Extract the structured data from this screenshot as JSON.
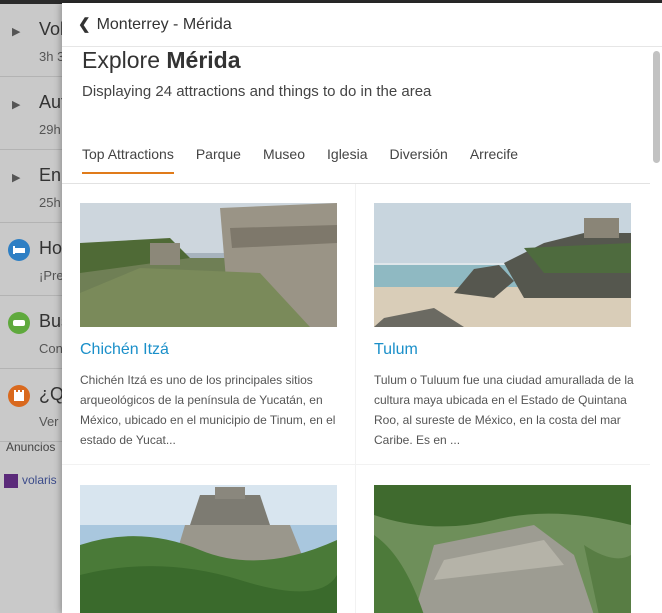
{
  "background": {
    "rows": [
      {
        "title": "Vol",
        "sub": "3h 3"
      },
      {
        "title": "Aut",
        "sub": "29h"
      },
      {
        "title": "En",
        "sub": "25h"
      },
      {
        "title": "Hot",
        "sub": "¡Pre"
      },
      {
        "title": "Bus",
        "sub": "Con"
      },
      {
        "title": "¿Qu",
        "sub": "Ver"
      }
    ],
    "ads_label": "Anuncios",
    "volaris_label": "volaris"
  },
  "header": {
    "route": "Monterrey - Mérida"
  },
  "page": {
    "explore_prefix": "Explore",
    "explore_city": "Mérida",
    "subtitle": "Displaying 24 attractions and things to do in the area"
  },
  "tabs": [
    {
      "label": "Top Attractions",
      "active": true
    },
    {
      "label": "Parque"
    },
    {
      "label": "Museo"
    },
    {
      "label": "Iglesia"
    },
    {
      "label": "Diversión"
    },
    {
      "label": "Arrecife"
    }
  ],
  "attractions": [
    {
      "name": "Chichén Itzá",
      "description": "Chichén Itzá es uno de los principales sitios arqueológicos de la península de Yucatán, en México, ubicado en el municipio de Tinum, en el estado de Yucat..."
    },
    {
      "name": "Tulum",
      "description": "Tulum o Tuluum fue una ciudad amurallada de la cultura maya ubicada en el Estado de Quintana Roo, al sureste de México, en la costa del mar Caribe. Es en ..."
    }
  ],
  "colors": {
    "accent_tab": "#e07b1a",
    "link": "#1a8fc9"
  }
}
